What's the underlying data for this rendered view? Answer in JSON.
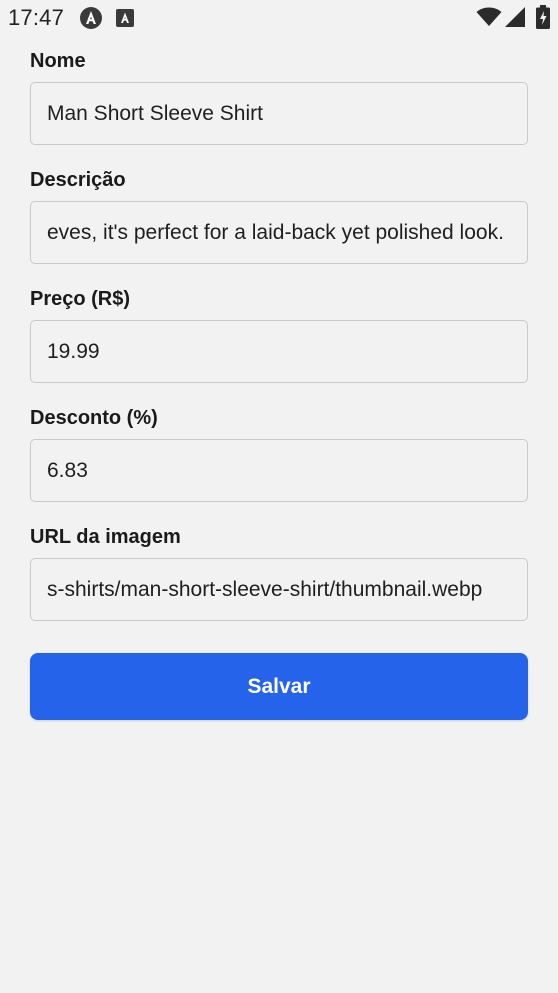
{
  "status_bar": {
    "time": "17:47",
    "icons": [
      "angular-app-icon",
      "text-app-icon",
      "wifi-icon",
      "signal-icon",
      "battery-charging-icon"
    ]
  },
  "form": {
    "fields": [
      {
        "label": "Nome",
        "value": "Man Short Sleeve Shirt"
      },
      {
        "label": "Descrição",
        "value": "eves, it's perfect for a laid-back yet polished look."
      },
      {
        "label": "Preço (R$)",
        "value": "19.99"
      },
      {
        "label": "Desconto (%)",
        "value": "6.83"
      },
      {
        "label": "URL da imagem",
        "value": "s-shirts/man-short-sleeve-shirt/thumbnail.webp"
      }
    ],
    "submit_label": "Salvar"
  },
  "colors": {
    "background": "#f2f2f2",
    "accent": "#2563eb",
    "input_border": "#c9c9c9"
  }
}
